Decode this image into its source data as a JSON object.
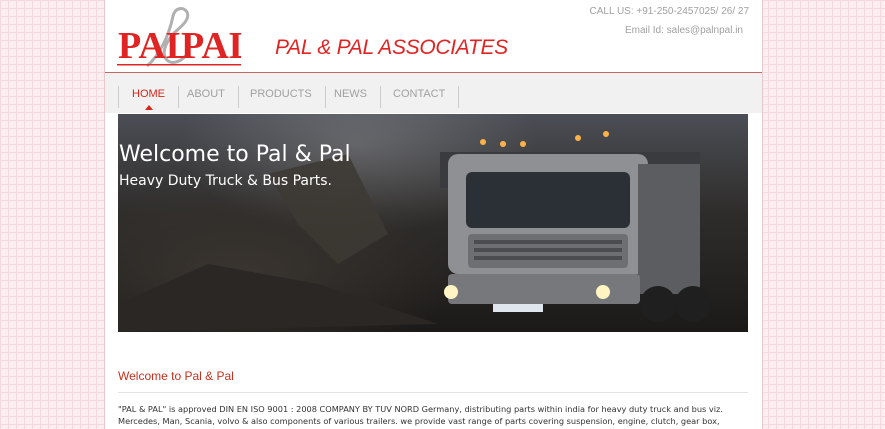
{
  "header": {
    "logo_text": "PAL&PAL",
    "title": "PAL & PAL ASSOCIATES",
    "phone": "CALL US: +91-250-2457025/ 26/ 27",
    "email": "Email Id: sales@palnpal.in"
  },
  "nav": {
    "items": [
      {
        "label": "HOME",
        "active": true
      },
      {
        "label": "ABOUT",
        "active": false
      },
      {
        "label": "PRODUCTS",
        "active": false
      },
      {
        "label": "NEWS",
        "active": false
      },
      {
        "label": "CONTACT",
        "active": false
      }
    ]
  },
  "banner": {
    "title": "Welcome to Pal & Pal",
    "subtitle": "Heavy Duty Truck & Bus Parts."
  },
  "content": {
    "heading": "Welcome to Pal & Pal",
    "paragraph": "\"PAL & PAL\" is approved DIN EN ISO 9001 : 2008 COMPANY BY TUV NORD Germany, distributing parts within india for heavy duty truck and bus viz. Mercedes, Man, Scania, volvo & also components of various trailers. we provide vast range of parts covering suspension, engine, clutch, gear box,"
  },
  "colors": {
    "accent": "#e02424",
    "nav_active": "#d7261c",
    "heading": "#c8301e"
  }
}
